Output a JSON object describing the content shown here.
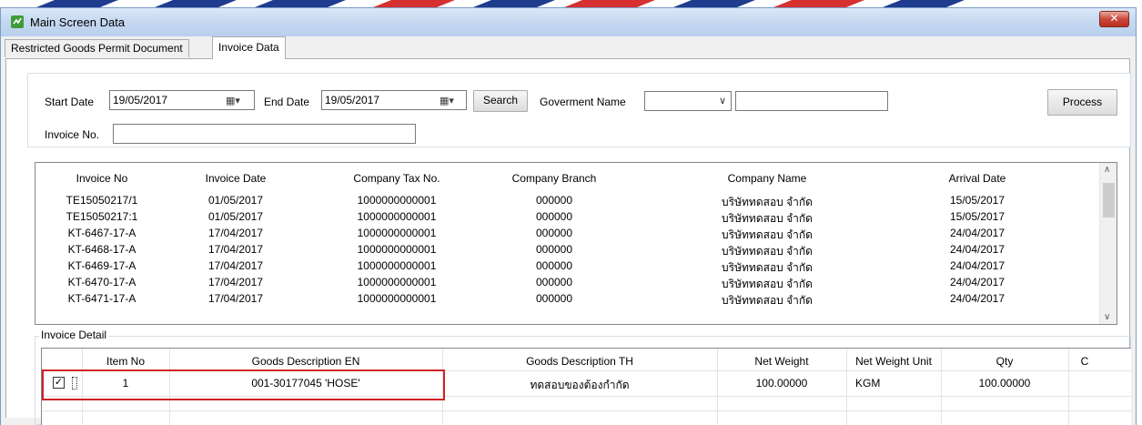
{
  "window": {
    "title": "Main Screen Data",
    "close_label": "✕"
  },
  "tabs": [
    {
      "label": "Restricted Goods Permit Document"
    },
    {
      "label": "Invoice Data"
    }
  ],
  "filters": {
    "start_date_label": "Start Date",
    "start_date_value": "19/05/2017",
    "end_date_label": "End Date",
    "end_date_value": "19/05/2017",
    "search_label": "Search",
    "government_label": "Goverment Name",
    "government_value": "",
    "government_text": "",
    "process_label": "Process",
    "invoice_no_label": "Invoice No.",
    "invoice_no_value": ""
  },
  "invoice_grid": {
    "headers": [
      "Invoice No",
      "Invoice Date",
      "Company Tax No.",
      "Company Branch",
      "Company Name",
      "Arrival Date"
    ],
    "rows": [
      [
        "TE15050217/1",
        "01/05/2017",
        "1000000000001",
        "000000",
        "บริษัททดสอบ จำกัด",
        "15/05/2017"
      ],
      [
        "TE15050217:1",
        "01/05/2017",
        "1000000000001",
        "000000",
        "บริษัททดสอบ จำกัด",
        "15/05/2017"
      ],
      [
        "KT-6467-17-A",
        "17/04/2017",
        "1000000000001",
        "000000",
        "บริษัททดสอบ จำกัด",
        "24/04/2017"
      ],
      [
        "KT-6468-17-A",
        "17/04/2017",
        "1000000000001",
        "000000",
        "บริษัททดสอบ จำกัด",
        "24/04/2017"
      ],
      [
        "KT-6469-17-A",
        "17/04/2017",
        "1000000000001",
        "000000",
        "บริษัททดสอบ จำกัด",
        "24/04/2017"
      ],
      [
        "KT-6470-17-A",
        "17/04/2017",
        "1000000000001",
        "000000",
        "บริษัททดสอบ จำกัด",
        "24/04/2017"
      ],
      [
        "KT-6471-17-A",
        "17/04/2017",
        "1000000000001",
        "000000",
        "บริษัททดสอบ จำกัด",
        "24/04/2017"
      ]
    ]
  },
  "invoice_detail": {
    "legend": "Invoice Detail",
    "headers": [
      "Item No",
      "Goods Description EN",
      "Goods Description TH",
      "Net Weight",
      "Net Weight Unit",
      "Qty",
      "C"
    ],
    "rows": [
      {
        "checked": true,
        "item_no": "1",
        "desc_en": "001-30177045 'HOSE'",
        "desc_th": "ทดสอบของต้องกำกัด",
        "net_weight": "100.00000",
        "unit": "KGM",
        "qty": "100.00000"
      }
    ]
  },
  "icons": {
    "app": "app-icon",
    "calendar": "calendar-dropdown-icon",
    "chevron": "chevron-down-icon",
    "scroll_up": "scroll-up-icon",
    "scroll_down": "scroll-down-icon"
  },
  "colors": {
    "highlight": "#d22027",
    "titlebar": "#c6d9f1"
  }
}
